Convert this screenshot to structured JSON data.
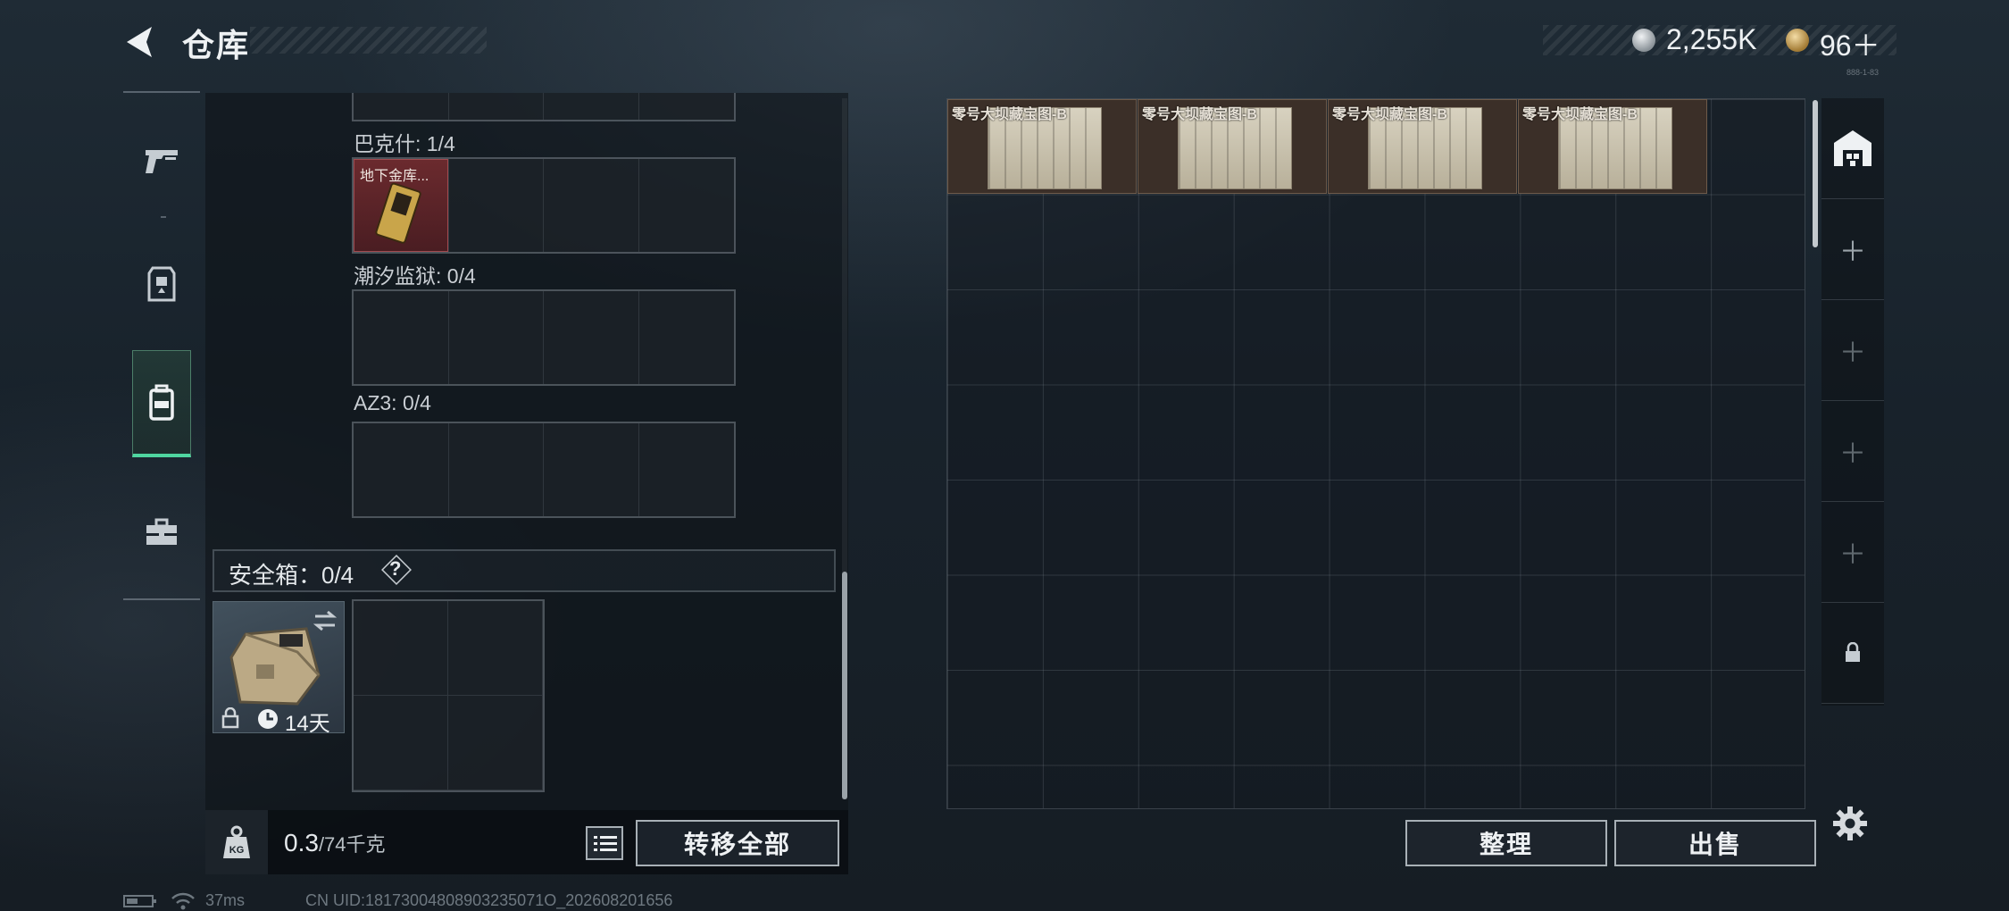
{
  "header": {
    "title": "仓库",
    "currency_1": "2,255K",
    "currency_2": "96＋",
    "tiny_text": "888-1-83"
  },
  "left_tabs": [
    {
      "icon": "pistol-icon",
      "active": false
    },
    {
      "icon": "armor-icon",
      "active": false
    },
    {
      "icon": "backpack-icon",
      "active": true
    },
    {
      "icon": "toolbox-icon",
      "active": false
    }
  ],
  "keys_section": {
    "groups": [
      {
        "label": "巴克什: 1/4",
        "item_name": "地下金库..."
      },
      {
        "label": "潮汐监狱: 0/4"
      },
      {
        "label": "AZ3: 0/4"
      }
    ]
  },
  "safebox": {
    "title": "安全箱：0/4",
    "help": "?",
    "duration": "14天"
  },
  "weight": {
    "value": "0.3",
    "unit": "/74千克",
    "kg_label": "KG"
  },
  "buttons": {
    "transfer_all": "转移全部",
    "tidy": "整理",
    "sell": "出售"
  },
  "storage": {
    "items": [
      {
        "label": "零号大坝藏宝图-B"
      },
      {
        "label": "零号大坝藏宝图-B"
      },
      {
        "label": "零号大坝藏宝图-B"
      },
      {
        "label": "零号大坝藏宝图-B"
      }
    ]
  },
  "status_bar": {
    "ping": "37ms",
    "uid": "CN UID:18173004808903235071O_202608201656"
  }
}
